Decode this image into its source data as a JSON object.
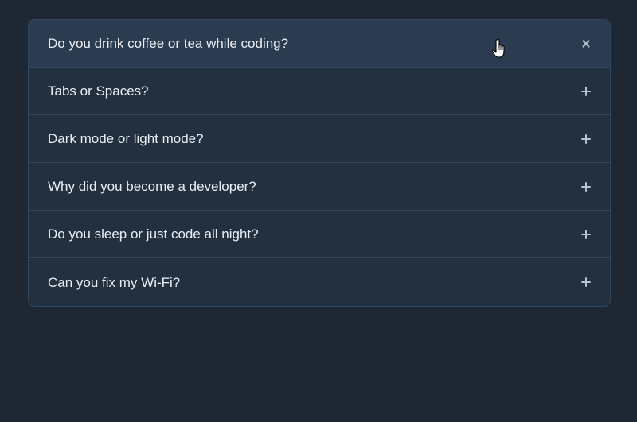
{
  "faq": {
    "items": [
      {
        "question": "Do you drink coffee or tea while coding?",
        "state": "hovered"
      },
      {
        "question": "Tabs or Spaces?",
        "state": "collapsed"
      },
      {
        "question": "Dark mode or light mode?",
        "state": "collapsed"
      },
      {
        "question": "Why did you become a developer?",
        "state": "collapsed"
      },
      {
        "question": "Do you sleep or just code all night?",
        "state": "collapsed"
      },
      {
        "question": "Can you fix my Wi-Fi?",
        "state": "collapsed"
      }
    ]
  },
  "icons": {
    "toggle": "plus-icon",
    "cursor": "hand-pointer-icon"
  },
  "colors": {
    "background": "#1e2835",
    "panel": "#223040",
    "hover": "#2b3c51",
    "divider": "#34475b",
    "text": "#e8edf3",
    "icon": "#b8c3cf"
  }
}
